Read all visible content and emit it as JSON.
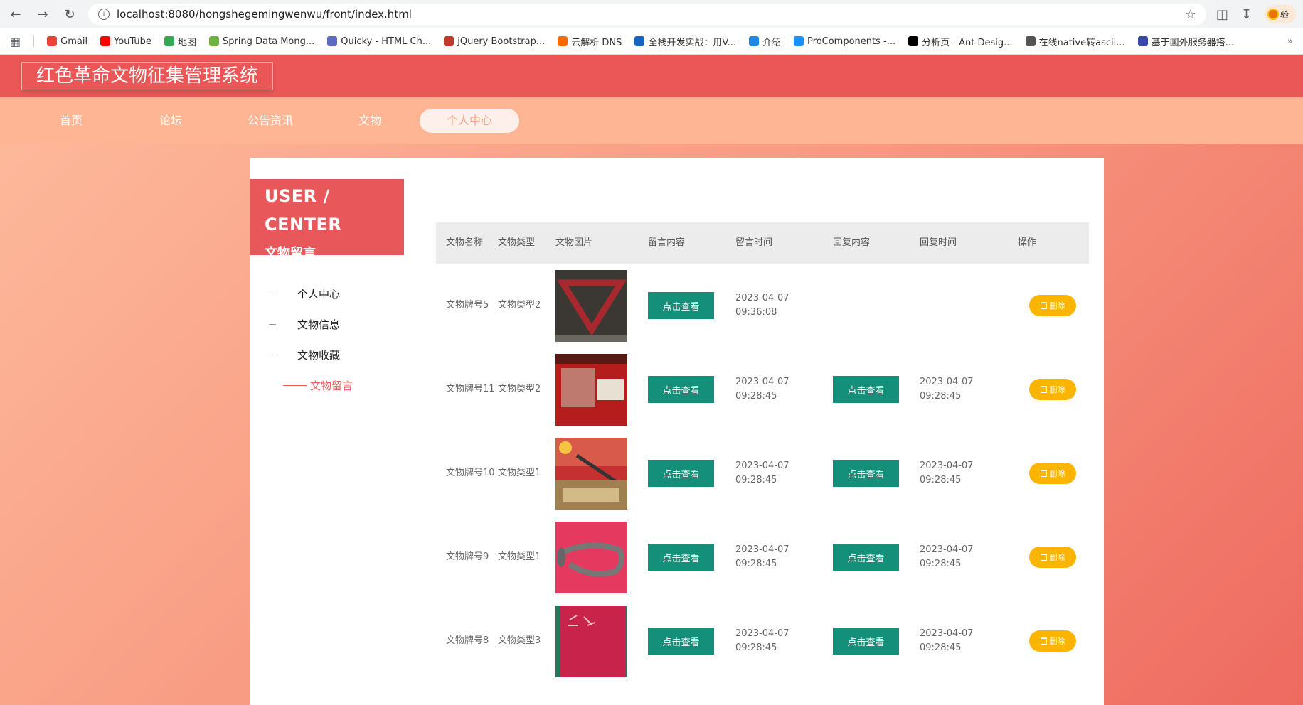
{
  "browser": {
    "url": "localhost:8080/hongshegemingwenwu/front/index.html",
    "profile_label": "验",
    "bookmarks": [
      {
        "label": "Gmail",
        "color": "#ea4335"
      },
      {
        "label": "YouTube",
        "color": "#ff0000"
      },
      {
        "label": "地图",
        "color": "#34a853"
      },
      {
        "label": "Spring Data Mong...",
        "color": "#6db33f"
      },
      {
        "label": "Quicky - HTML Ch...",
        "color": "#5c6bc0"
      },
      {
        "label": "jQuery Bootstrap...",
        "color": "#c0392b"
      },
      {
        "label": "云解析 DNS",
        "color": "#ff6a00"
      },
      {
        "label": "全栈开发实战：用V...",
        "color": "#1565c0"
      },
      {
        "label": "介绍",
        "color": "#1e88e5"
      },
      {
        "label": "ProComponents -...",
        "color": "#1890ff"
      },
      {
        "label": "分析页 - Ant Desig...",
        "color": "#000000"
      },
      {
        "label": "在线native转ascii...",
        "color": "#555555"
      },
      {
        "label": "基于国外服务器搭...",
        "color": "#3949ab"
      }
    ]
  },
  "site": {
    "title": "红色革命文物征集管理系统",
    "nav": [
      {
        "label": "首页",
        "active": false
      },
      {
        "label": "论坛",
        "active": false
      },
      {
        "label": "公告资讯",
        "active": false
      },
      {
        "label": "文物",
        "active": false
      },
      {
        "label": "个人中心",
        "active": true
      }
    ]
  },
  "sidebar": {
    "heading_en": "USER / CENTER",
    "heading_cn": "文物留言",
    "items": [
      {
        "label": "个人中心",
        "active": false
      },
      {
        "label": "文物信息",
        "active": false
      },
      {
        "label": "文物收藏",
        "active": false
      },
      {
        "label": "文物留言",
        "active": true
      }
    ]
  },
  "table": {
    "headers": [
      "文物名称",
      "文物类型",
      "文物图片",
      "留言内容",
      "留言时间",
      "回复内容",
      "回复时间",
      "操作"
    ],
    "view_label": "点击查看",
    "delete_label": "删除",
    "rows": [
      {
        "name": "文物牌号5",
        "type": "文物类型2",
        "image": "red-triangle-scarf",
        "msg_time": "2023-04-07 09:36:08",
        "has_reply": false,
        "reply_time": ""
      },
      {
        "name": "文物牌号11",
        "type": "文物类型2",
        "image": "red-display-case",
        "msg_time": "2023-04-07 09:28:45",
        "has_reply": true,
        "reply_time": "2023-04-07 09:28:45"
      },
      {
        "name": "文物牌号10",
        "type": "文物类型1",
        "image": "machine-gun-exhibit",
        "msg_time": "2023-04-07 09:28:45",
        "has_reply": true,
        "reply_time": "2023-04-07 09:28:45"
      },
      {
        "name": "文物牌号9",
        "type": "文物类型1",
        "image": "bugle-on-red",
        "msg_time": "2023-04-07 09:28:45",
        "has_reply": true,
        "reply_time": "2023-04-07 09:28:45"
      },
      {
        "name": "文物牌号8",
        "type": "文物类型3",
        "image": "red-book-cover",
        "msg_time": "2023-04-07 09:28:45",
        "has_reply": true,
        "reply_time": "2023-04-07 09:28:45"
      }
    ]
  }
}
